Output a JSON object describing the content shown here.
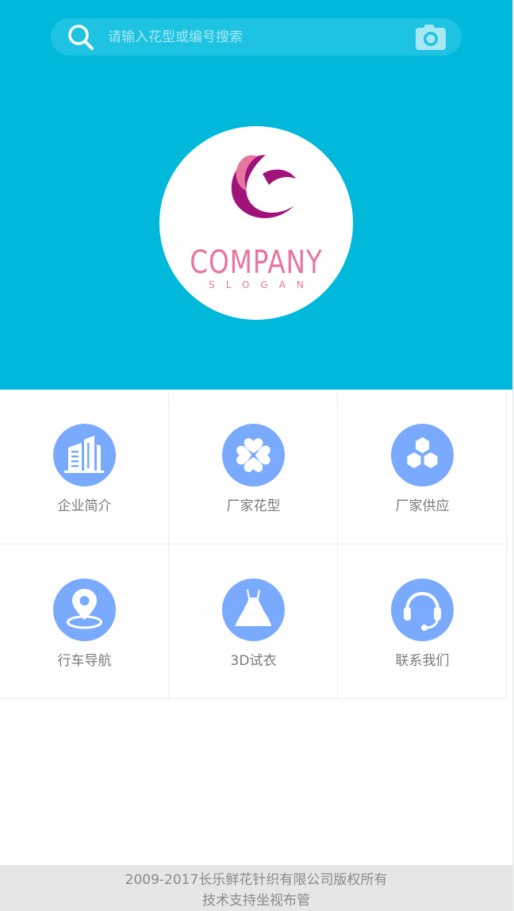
{
  "search": {
    "placeholder": "请输入花型或编号搜索",
    "icon": "search-icon",
    "camera_icon": "camera-icon"
  },
  "logo": {
    "word": "COMPANY",
    "slogan": "SLOGAN"
  },
  "menu": [
    {
      "label": "企业简介",
      "icon": "building-icon"
    },
    {
      "label": "厂家花型",
      "icon": "clover-icon"
    },
    {
      "label": "厂家供应",
      "icon": "hexagons-icon"
    },
    {
      "label": "行车导航",
      "icon": "location-pin-icon"
    },
    {
      "label": "3D试衣",
      "icon": "dress-icon"
    },
    {
      "label": "联系我们",
      "icon": "headset-icon"
    }
  ],
  "footer": {
    "copyright": "2009-2017长乐鲜花针织有限公司版权所有",
    "support": "技术支持坐视布管"
  },
  "colors": {
    "header_bg": "#00b8da",
    "icon_circle": "#79aafe",
    "logo_pink": "#e8759f",
    "logo_purple": "#a0127a",
    "footer_bg": "#e6e6e6"
  }
}
